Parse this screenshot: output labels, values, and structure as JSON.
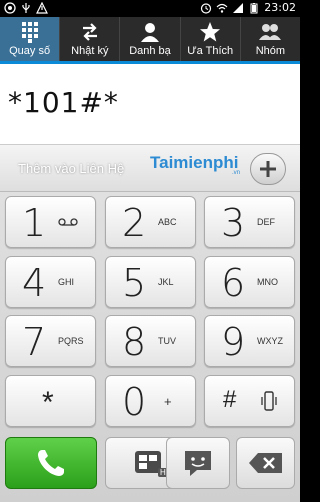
{
  "status_bar": {
    "time": "23:02",
    "left_icons": [
      "whatsapp-icon",
      "usb-icon",
      "warning-icon"
    ],
    "right_icons": [
      "alarm-icon",
      "wifi-icon",
      "signal-icon",
      "battery-icon"
    ]
  },
  "tabs": [
    {
      "label": "Quay số",
      "icon": "dialpad-icon",
      "active": true
    },
    {
      "label": "Nhật ký",
      "icon": "call-log-icon",
      "active": false
    },
    {
      "label": "Danh bạ",
      "icon": "contacts-icon",
      "active": false
    },
    {
      "label": "Ưa Thích",
      "icon": "star-icon",
      "active": false
    },
    {
      "label": "Nhóm",
      "icon": "group-icon",
      "active": false
    }
  ],
  "display": {
    "number": "*101#*"
  },
  "add_contact": {
    "label": "Thêm vào Liên Hệ",
    "watermark": "Taimienphi",
    "watermark_sub": ".vn"
  },
  "keys": [
    {
      "digit": "1",
      "letters": "",
      "icon": "voicemail-icon"
    },
    {
      "digit": "2",
      "letters": "ABC"
    },
    {
      "digit": "3",
      "letters": "DEF"
    },
    {
      "digit": "4",
      "letters": "GHI"
    },
    {
      "digit": "5",
      "letters": "JKL"
    },
    {
      "digit": "6",
      "letters": "MNO"
    },
    {
      "digit": "7",
      "letters": "PQRS"
    },
    {
      "digit": "8",
      "letters": "TUV"
    },
    {
      "digit": "9",
      "letters": "WXYZ"
    },
    {
      "digit": "*",
      "letters": ""
    },
    {
      "digit": "0",
      "letters": "+"
    },
    {
      "digit": "#",
      "letters": "",
      "icon": "vibrate-icon"
    }
  ],
  "actions": {
    "call": "call-icon",
    "video": "video-call-icon",
    "video_badge": "HD",
    "sms": "sms-icon",
    "delete": "backspace-icon"
  },
  "colors": {
    "accent": "#0a8ad7",
    "active_tab": "#3a6f96",
    "call_green": "#3fb52a"
  }
}
